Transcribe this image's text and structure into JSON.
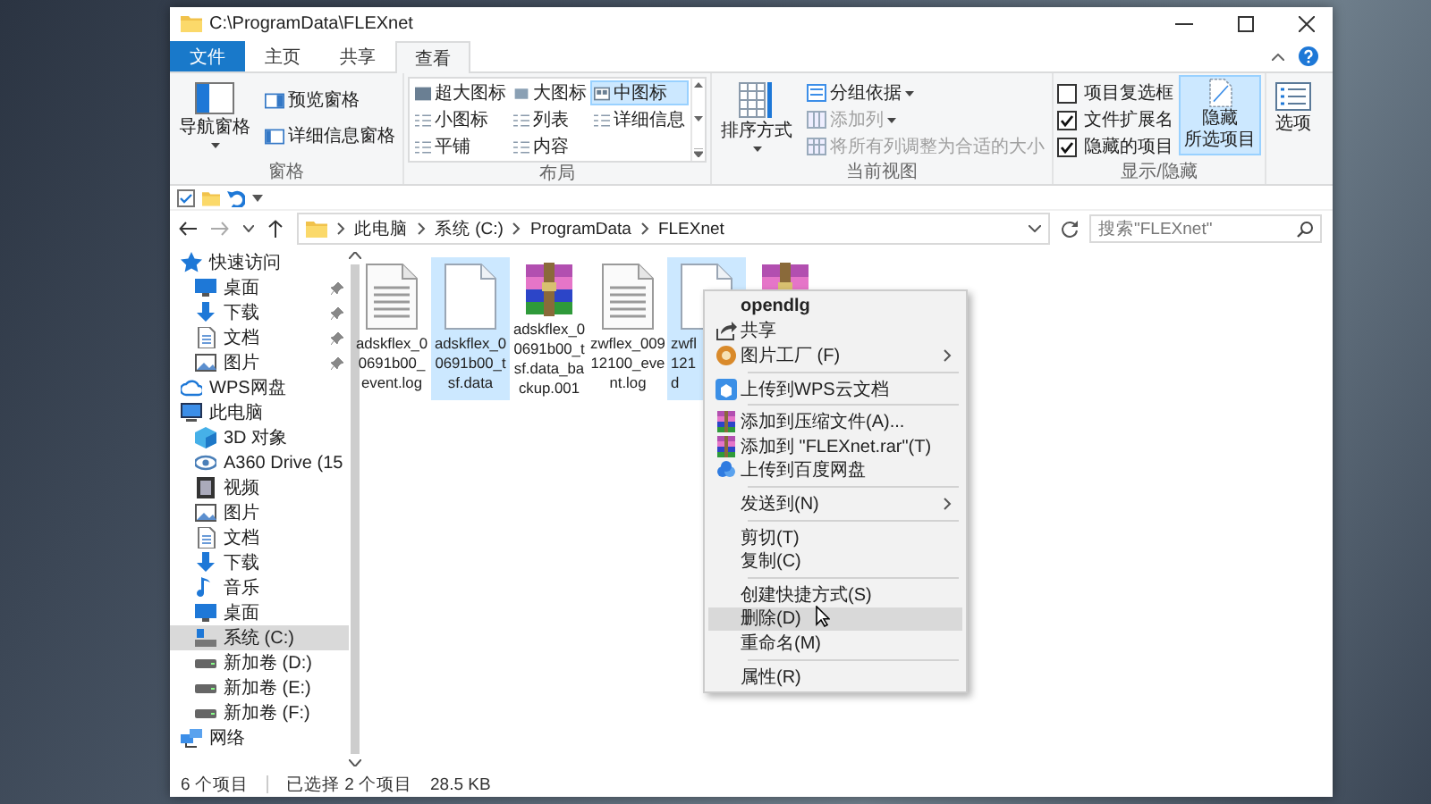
{
  "window": {
    "title": "C:\\ProgramData\\FLEXnet"
  },
  "ribbon_tabs": [
    {
      "label": "文件",
      "kind": "file",
      "selected": false
    },
    {
      "label": "主页",
      "kind": "tab",
      "selected": false
    },
    {
      "label": "共享",
      "kind": "tab",
      "selected": false
    },
    {
      "label": "查看",
      "kind": "tab",
      "selected": true
    }
  ],
  "ribbon": {
    "pane_group": {
      "label": "窗格",
      "nav_pane": "导航窗格",
      "preview_pane": "预览窗格",
      "details_pane": "详细信息窗格"
    },
    "layout_group": {
      "label": "布局",
      "options": [
        {
          "label": "超大图标",
          "selected": false
        },
        {
          "label": "大图标",
          "selected": false
        },
        {
          "label": "中图标",
          "selected": true
        },
        {
          "label": "小图标",
          "selected": false
        },
        {
          "label": "列表",
          "selected": false
        },
        {
          "label": "详细信息",
          "selected": false
        },
        {
          "label": "平铺",
          "selected": false
        },
        {
          "label": "内容",
          "selected": false
        }
      ]
    },
    "current_view_group": {
      "label": "当前视图",
      "sort_by": "排序方式",
      "group_by": {
        "label": "分组依据",
        "disabled": false
      },
      "add_column": {
        "label": "添加列",
        "disabled": true
      },
      "size_columns": {
        "label": "将所有列调整为合适的大小",
        "disabled": true
      }
    },
    "show_hide_group": {
      "label": "显示/隐藏",
      "checkboxes": [
        {
          "label": "项目复选框",
          "checked": false
        },
        {
          "label": "文件扩展名",
          "checked": true
        },
        {
          "label": "隐藏的项目",
          "checked": true
        }
      ],
      "hide_selected": {
        "lines": [
          "隐藏",
          "所选项目"
        ],
        "pressed": true
      }
    },
    "options": "选项"
  },
  "address_bar": {
    "breadcrumbs": [
      "此电脑",
      "系统 (C:)",
      "ProgramData",
      "FLEXnet"
    ]
  },
  "search": {
    "placeholder": "搜索\"FLEXnet\""
  },
  "nav": {
    "items": [
      {
        "label": "快速访问",
        "kind": "star",
        "selected": false,
        "children": [
          {
            "label": "桌面",
            "kind": "desktop",
            "pinned": true,
            "selected": false
          },
          {
            "label": "下载",
            "kind": "download",
            "pinned": true,
            "selected": false
          },
          {
            "label": "文档",
            "kind": "document",
            "pinned": true,
            "selected": false
          },
          {
            "label": "图片",
            "kind": "pictures",
            "pinned": true,
            "selected": false
          }
        ]
      },
      {
        "label": "WPS网盘",
        "kind": "cloud",
        "selected": false
      },
      {
        "label": "此电脑",
        "kind": "pc",
        "selected": false,
        "children": [
          {
            "label": "3D 对象",
            "kind": "cube",
            "selected": false
          },
          {
            "label": "A360 Drive (15",
            "kind": "eye",
            "selected": false
          },
          {
            "label": "视频",
            "kind": "video",
            "selected": false
          },
          {
            "label": "图片",
            "kind": "pictures",
            "selected": false
          },
          {
            "label": "文档",
            "kind": "document",
            "selected": false
          },
          {
            "label": "下载",
            "kind": "download",
            "selected": false
          },
          {
            "label": "音乐",
            "kind": "music",
            "selected": false
          },
          {
            "label": "桌面",
            "kind": "desktop",
            "selected": false
          },
          {
            "label": "系统 (C:)",
            "kind": "system-drive",
            "selected": true
          },
          {
            "label": "新加卷 (D:)",
            "kind": "drive",
            "selected": false
          },
          {
            "label": "新加卷 (E:)",
            "kind": "drive",
            "selected": false
          },
          {
            "label": "新加卷 (F:)",
            "kind": "drive",
            "selected": false
          }
        ]
      },
      {
        "label": "网络",
        "kind": "network",
        "selected": false
      }
    ]
  },
  "files": [
    {
      "label_lines": [
        "adskflex_0",
        "0691b00_",
        "event.log"
      ],
      "kind": "text",
      "selected": false,
      "cut_off": false
    },
    {
      "label_lines": [
        "adskflex_0",
        "0691b00_t",
        "sf.data"
      ],
      "kind": "blank",
      "selected": true,
      "cut_off": false
    },
    {
      "label_lines": [
        "adskflex_0",
        "0691b00_t",
        "sf.data_ba",
        "ckup.001"
      ],
      "kind": "archive",
      "selected": false,
      "cut_off": false
    },
    {
      "label_lines": [
        "zwflex_009",
        "12100_eve",
        "nt.log"
      ],
      "kind": "text",
      "selected": false,
      "cut_off": false
    },
    {
      "label_lines": [
        "zwfl",
        "121",
        "d"
      ],
      "kind": "blank",
      "selected": true,
      "cut_off": true
    },
    {
      "kind": "archive",
      "selected": false,
      "cut_off": true
    }
  ],
  "context_menu": {
    "groups": [
      {
        "items": [
          {
            "label": "opendlg",
            "kind": "default",
            "submenu": false,
            "highlighted": false
          },
          {
            "label": "共享",
            "kind": "share",
            "submenu": false,
            "highlighted": false
          },
          {
            "label": "图片工厂 (F)",
            "kind": "app",
            "submenu": true,
            "highlighted": false
          }
        ]
      },
      {
        "items": [
          {
            "label": "上传到WPS云文档",
            "kind": "cloud-upload",
            "submenu": false,
            "highlighted": false
          }
        ]
      },
      {
        "items": [
          {
            "label": "添加到压缩文件(A)...",
            "kind": "archive",
            "submenu": false,
            "highlighted": false
          },
          {
            "label": "添加到 \"FLEXnet.rar\"(T)",
            "kind": "archive",
            "submenu": false,
            "highlighted": false
          },
          {
            "label": "上传到百度网盘",
            "kind": "netdisk",
            "submenu": false,
            "highlighted": false
          }
        ]
      },
      {
        "items": [
          {
            "label": "发送到(N)",
            "kind": "plain",
            "submenu": true,
            "highlighted": false
          }
        ]
      },
      {
        "items": [
          {
            "label": "剪切(T)",
            "kind": "plain",
            "submenu": false,
            "highlighted": false
          },
          {
            "label": "复制(C)",
            "kind": "plain",
            "submenu": false,
            "highlighted": false
          }
        ]
      },
      {
        "items": [
          {
            "label": "创建快捷方式(S)",
            "kind": "plain",
            "submenu": false,
            "highlighted": false
          },
          {
            "label": "删除(D)",
            "kind": "plain",
            "submenu": false,
            "highlighted": true
          },
          {
            "label": "重命名(M)",
            "kind": "plain",
            "submenu": false,
            "highlighted": false
          }
        ]
      },
      {
        "items": [
          {
            "label": "属性(R)",
            "kind": "plain",
            "submenu": false,
            "highlighted": false
          }
        ]
      }
    ]
  },
  "status_bar": {
    "item_count": "6 个项目",
    "selection": "已选择 2 个项目",
    "size": "28.5 KB"
  }
}
